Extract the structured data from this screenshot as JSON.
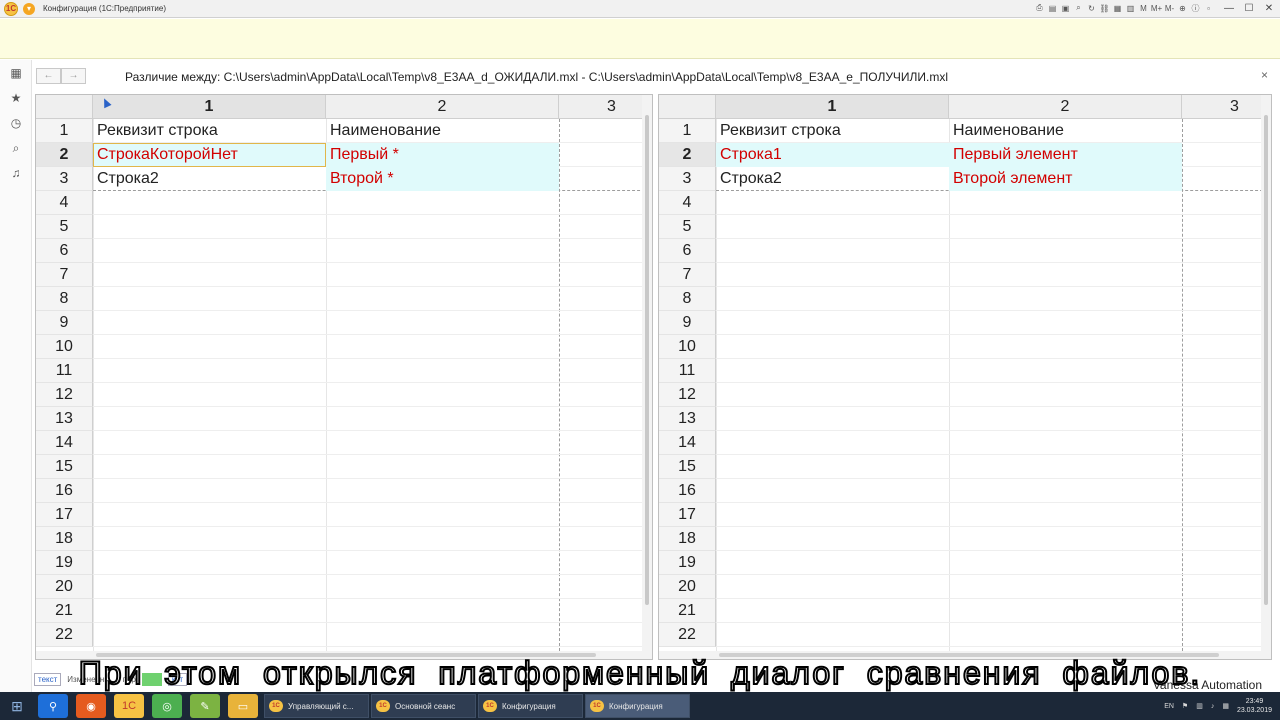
{
  "app": {
    "title": "Конфигурация  (1С:Предприятие)"
  },
  "window": {
    "title": "Различие между: C:\\Users\\admin\\AppData\\Local\\Temp\\v8_E3AA_d_ОЖИДАЛИ.mxl - C:\\Users\\admin\\AppData\\Local\\Temp\\v8_E3AA_e_ПОЛУЧИЛИ.mxl",
    "close": "×"
  },
  "titlebar_tools": [
    "M",
    "M+",
    "M-"
  ],
  "left_panel": {
    "columns": [
      "1",
      "2",
      "3"
    ],
    "rows": [
      "1",
      "2",
      "3",
      "4",
      "5",
      "6",
      "7",
      "8",
      "9",
      "10",
      "11",
      "12",
      "13",
      "14",
      "15",
      "16",
      "17",
      "18",
      "19",
      "20",
      "21",
      "22"
    ],
    "cells": [
      [
        "Реквизит строка",
        "Наименование"
      ],
      [
        "СтрокаКоторойНет",
        "Первый *"
      ],
      [
        "Строка2",
        "Второй *"
      ]
    ]
  },
  "right_panel": {
    "columns": [
      "1",
      "2",
      "3"
    ],
    "rows": [
      "1",
      "2",
      "3",
      "4",
      "5",
      "6",
      "7",
      "8",
      "9",
      "10",
      "11",
      "12",
      "13",
      "14",
      "15",
      "16",
      "17",
      "18",
      "19",
      "20",
      "21",
      "22"
    ],
    "cells": [
      [
        "Реквизит строка",
        "Наименование"
      ],
      [
        "Строка1",
        "Первый элемент"
      ],
      [
        "Строка2",
        "Второй элемент"
      ]
    ]
  },
  "status": {
    "tag1": "текст",
    "label": "Измененны",
    "mid": "в пер",
    "tag2": "кст"
  },
  "brand": "Vanessa Automation",
  "subtitle": "При этом открылся платформенный диалог сравнения файлов.",
  "taskbar": {
    "tasks": [
      "Управляющий с...",
      "Основной сеанс",
      "Конфигурация",
      "Конфигурация"
    ],
    "lang": "EN",
    "time": "23:49",
    "date": "23.03.2019"
  },
  "colors": {
    "diff_bg": "#e0fafb",
    "diff_text": "#d20000",
    "accent": "#f6c244"
  }
}
